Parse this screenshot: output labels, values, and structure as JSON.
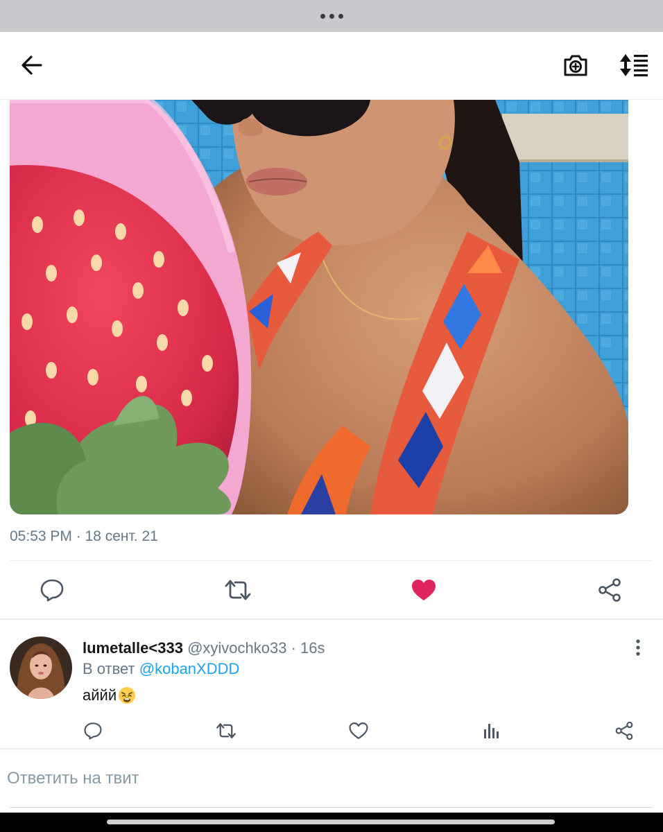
{
  "header": {
    "back_icon": "arrow-left-icon",
    "camera_icon": "camera-plus-icon",
    "sort_icon": "sort-list-icon"
  },
  "tweet": {
    "timestamp": "05:53 PM · 18 сент. 21",
    "liked": true,
    "like_color": "#e0245e",
    "actions": [
      "reply-icon",
      "retweet-icon",
      "heart-icon",
      "share-icon"
    ]
  },
  "reply": {
    "display_name": "lumetalle<333",
    "handle": "@xyivochko33 · 16s",
    "reply_to_prefix": "В ответ",
    "reply_to_mention": "@kobanXDDD",
    "text": "аййй",
    "text_emoji": "weary-face-emoji",
    "mention_color": "#1da1f2",
    "actions": [
      "reply-icon",
      "retweet-icon",
      "heart-icon",
      "analytics-icon",
      "share-icon"
    ]
  },
  "compose": {
    "placeholder": "Ответить на твит"
  }
}
